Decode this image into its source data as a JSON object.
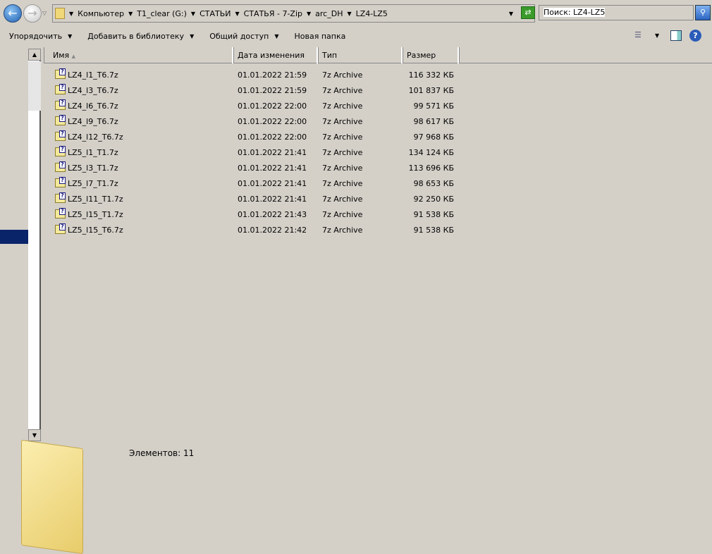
{
  "address": {
    "segments": [
      "Компьютер",
      "T1_clear (G:)",
      "СТАТЬИ",
      "СТАТЬЯ - 7-Zip",
      "arc_DH",
      "LZ4-LZ5"
    ]
  },
  "search": {
    "value": "Поиск: LZ4-LZ5"
  },
  "toolbar": {
    "organize": "Упорядочить",
    "add_library": "Добавить в библиотеку",
    "share": "Общий доступ",
    "new_folder": "Новая папка"
  },
  "columns": {
    "name": "Имя",
    "date": "Дата изменения",
    "type": "Тип",
    "size": "Размер"
  },
  "files": [
    {
      "name": "LZ4_l1_T6.7z",
      "date": "01.01.2022 21:59",
      "type": "7z Archive",
      "size": "116 332 КБ"
    },
    {
      "name": "LZ4_l3_T6.7z",
      "date": "01.01.2022 21:59",
      "type": "7z Archive",
      "size": "101 837 КБ"
    },
    {
      "name": "LZ4_l6_T6.7z",
      "date": "01.01.2022 22:00",
      "type": "7z Archive",
      "size": "99 571 КБ"
    },
    {
      "name": "LZ4_l9_T6.7z",
      "date": "01.01.2022 22:00",
      "type": "7z Archive",
      "size": "98 617 КБ"
    },
    {
      "name": "LZ4_l12_T6.7z",
      "date": "01.01.2022 22:00",
      "type": "7z Archive",
      "size": "97 968 КБ"
    },
    {
      "name": "LZ5_l1_T1.7z",
      "date": "01.01.2022 21:41",
      "type": "7z Archive",
      "size": "134 124 КБ"
    },
    {
      "name": "LZ5_l3_T1.7z",
      "date": "01.01.2022 21:41",
      "type": "7z Archive",
      "size": "113 696 КБ"
    },
    {
      "name": "LZ5_l7_T1.7z",
      "date": "01.01.2022 21:41",
      "type": "7z Archive",
      "size": "98 653 КБ"
    },
    {
      "name": "LZ5_l11_T1.7z",
      "date": "01.01.2022 21:41",
      "type": "7z Archive",
      "size": "92 250 КБ"
    },
    {
      "name": "LZ5_l15_T1.7z",
      "date": "01.01.2022 21:43",
      "type": "7z Archive",
      "size": "91 538 КБ"
    },
    {
      "name": "LZ5_l15_T6.7z",
      "date": "01.01.2022 21:42",
      "type": "7z Archive",
      "size": "91 538 КБ"
    }
  ],
  "details": {
    "count": "Элементов: 11"
  }
}
